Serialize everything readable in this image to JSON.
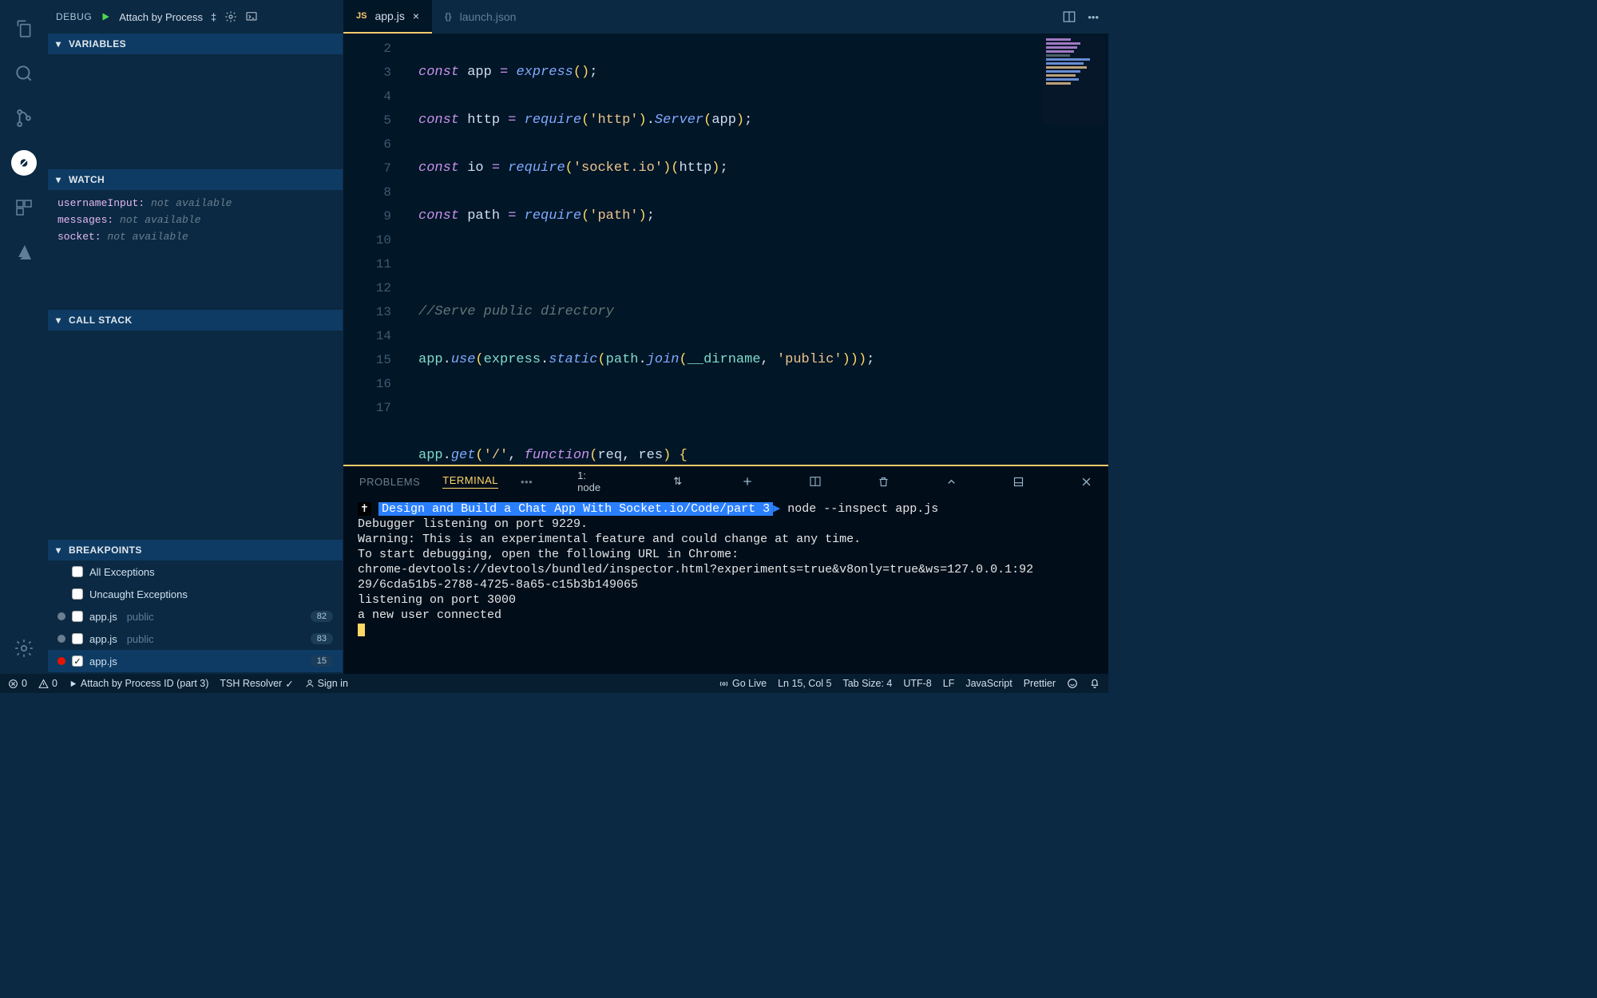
{
  "debug": {
    "label": "DEBUG",
    "config": "Attach by Process",
    "configMenuIndicator": "‡"
  },
  "sections": {
    "variables": "VARIABLES",
    "watch": "WATCH",
    "callStack": "CALL STACK",
    "breakpoints": "BREAKPOINTS"
  },
  "watch": [
    {
      "name": "usernameInput:",
      "value": "not available"
    },
    {
      "name": "messages:",
      "value": "not available"
    },
    {
      "name": "socket:",
      "value": "not available"
    }
  ],
  "breakpoints": {
    "allExceptions": "All Exceptions",
    "uncaughtExceptions": "Uncaught Exceptions",
    "items": [
      {
        "file": "app.js",
        "dir": "public",
        "line": "82",
        "active": false,
        "checked": false
      },
      {
        "file": "app.js",
        "dir": "public",
        "line": "83",
        "active": false,
        "checked": false
      },
      {
        "file": "app.js",
        "dir": "",
        "line": "15",
        "active": true,
        "checked": true
      }
    ]
  },
  "tabs": {
    "active": {
      "icon": "JS",
      "name": "app.js"
    },
    "inactive": {
      "icon": "{}",
      "name": "launch.json"
    }
  },
  "editor": {
    "startLine": 2,
    "highlightLine": 15,
    "breakpointLine": 15
  },
  "panel": {
    "problems": "PROBLEMS",
    "terminal": "TERMINAL",
    "more": "•••",
    "termSelector": "1: node"
  },
  "terminal": {
    "promptPath": "Design and Build a Chat App With Socket.io/Code/part 3",
    "promptCmd": "node --inspect app.js",
    "lines": [
      "Debugger listening on port 9229.",
      "Warning: This is an experimental feature and could change at any time.",
      "To start debugging, open the following URL in Chrome:",
      "    chrome-devtools://devtools/bundled/inspector.html?experiments=true&v8only=true&ws=127.0.0.1:92",
      "29/6cda51b5-2788-4725-8a65-c15b3b149065",
      "listening on port 3000",
      "a new user connected"
    ]
  },
  "status": {
    "errors": "0",
    "warnings": "0",
    "debugConfig": "Attach by Process ID (part 3)",
    "tsh": "TSH Resolver",
    "signIn": "Sign in",
    "goLive": "Go Live",
    "lnCol": "Ln 15, Col 5",
    "tabSize": "Tab Size: 4",
    "encoding": "UTF-8",
    "eol": "LF",
    "lang": "JavaScript",
    "prettier": "Prettier"
  }
}
